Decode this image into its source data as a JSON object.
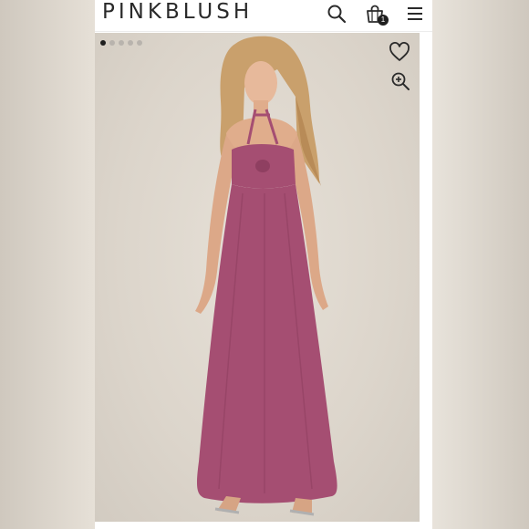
{
  "header": {
    "brand": "PINKBLUSH",
    "cart_count": "1",
    "icons": [
      "search-icon",
      "shopping-bag-icon",
      "hamburger-menu-icon"
    ]
  },
  "gallery": {
    "slide_count": 5,
    "active_slide": 1,
    "icons": [
      "heart-icon",
      "zoom-in-icon"
    ],
    "product_color": "#a54e72"
  }
}
